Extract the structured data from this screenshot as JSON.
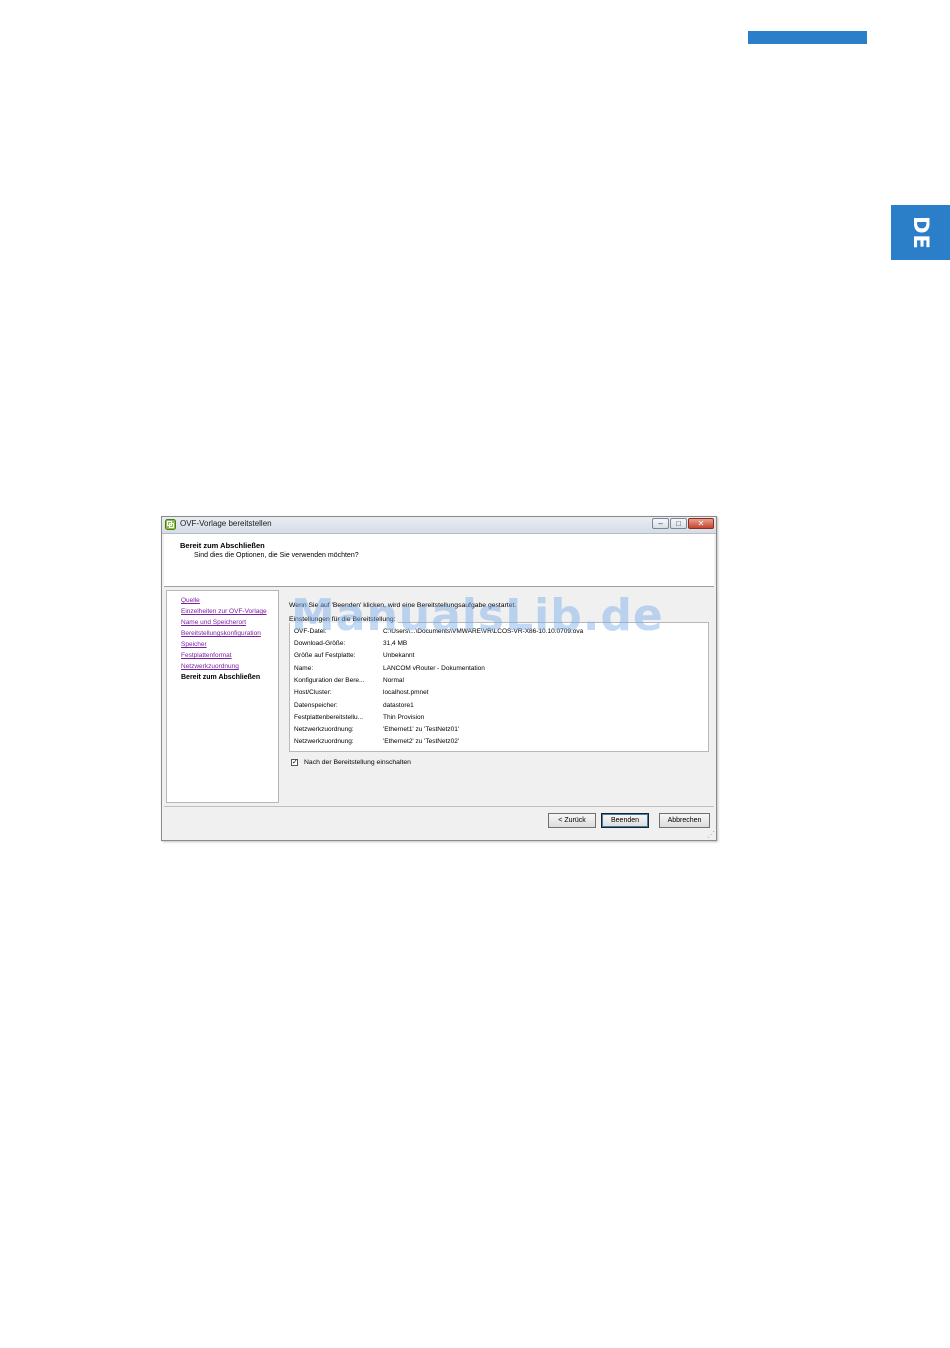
{
  "page": {
    "side_tab": "DE",
    "accent_color": "#2a7fc8",
    "watermark": "ManualsLib.de"
  },
  "window": {
    "title": "OVF-Vorlage bereitstellen",
    "controls": {
      "minimize": "–",
      "maximize": "□",
      "close": "✕"
    },
    "header": {
      "title": "Bereit zum Abschließen",
      "subtitle": "Sind dies die Optionen, die Sie verwenden möchten?"
    },
    "nav": [
      {
        "label": "Quelle",
        "current": false
      },
      {
        "label": "Einzelheiten zur OVF-Vorlage",
        "current": false
      },
      {
        "label": "Name und Speicherort",
        "current": false
      },
      {
        "label": "Bereitstellungskonfiguration",
        "current": false
      },
      {
        "label": "Speicher",
        "current": false
      },
      {
        "label": "Festplattenformat",
        "current": false
      },
      {
        "label": "Netzwerkzuordnung",
        "current": false
      },
      {
        "label": "Bereit zum Abschließen",
        "current": true
      }
    ],
    "content": {
      "intro": "Wenn Sie auf 'Beenden' klicken, wird eine Bereitstellungsaufgabe gestartet.",
      "group_label": "Einstellungen für die Bereitstellung:",
      "rows": [
        {
          "key": "OVF-Datei:",
          "value": "C:\\Users\\...\\Documents\\VMWARE\\VR\\LCOS-VR-X86-10.10.0709.ova"
        },
        {
          "key": "Download-Größe:",
          "value": "31,4 MB"
        },
        {
          "key": "Größe auf Festplatte:",
          "value": "Unbekannt"
        },
        {
          "key": "Name:",
          "value": "LANCOM vRouter - Dokumentation"
        },
        {
          "key": "Konfiguration der Bere...",
          "value": "Normal"
        },
        {
          "key": "Host/Cluster:",
          "value": "localhost.pmnet"
        },
        {
          "key": "Datenspeicher:",
          "value": "datastore1"
        },
        {
          "key": "Festplattenbereitstellu...",
          "value": "Thin Provision"
        },
        {
          "key": "Netzwerkzuordnung:",
          "value": "'Ethernet1' zu 'TestNetz01'"
        },
        {
          "key": "Netzwerkzuordnung:",
          "value": "'Ethernet2' zu 'TestNetz02'"
        }
      ],
      "checkbox": {
        "label": "Nach der Bereitstellung einschalten",
        "checked": true,
        "mark": "✓"
      }
    },
    "buttons": {
      "back": "< Zurück",
      "finish": "Beenden",
      "cancel": "Abbrechen"
    }
  }
}
